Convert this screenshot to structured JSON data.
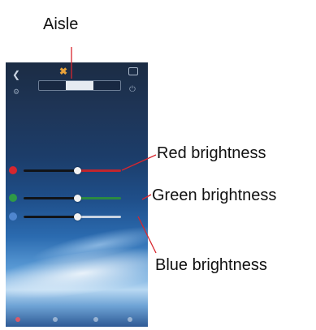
{
  "callouts": {
    "aisle": "Aisle",
    "red": "Red brightness",
    "green": "Green brightness",
    "blue": "Blue brightness"
  },
  "colors": {
    "callout_line": "#d8262e",
    "red_channel": "#c0262d",
    "green_channel": "#2c8a41",
    "blue_channel": "#4f86cf"
  },
  "phone": {
    "back_icon": "chevron-left",
    "tabs": [
      {
        "label": "",
        "active": false
      },
      {
        "label": "",
        "active": true
      },
      {
        "label": "",
        "active": false
      }
    ],
    "sliders": [
      {
        "channel": "red",
        "level": 0.55
      },
      {
        "channel": "green",
        "level": 0.55
      },
      {
        "channel": "blue",
        "level": 0.55
      }
    ]
  }
}
